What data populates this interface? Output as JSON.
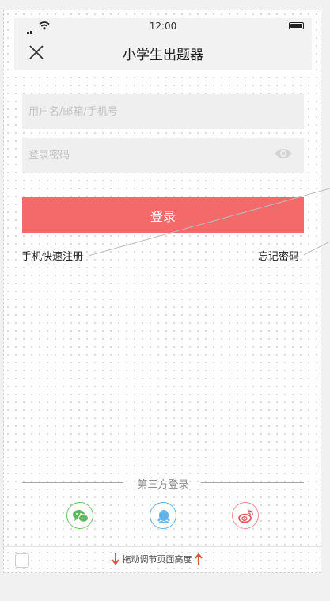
{
  "statusbar": {
    "time": "12:00"
  },
  "navbar": {
    "title": "小学生出题器"
  },
  "form": {
    "username_placeholder": "用户名/邮箱/手机号",
    "password_placeholder": "登录密码",
    "login_label": "登录",
    "register_link": "手机快速注册",
    "forgot_link": "忘记密码"
  },
  "third_party": {
    "label": "第三方登录",
    "providers": [
      "wechat-icon",
      "qq-icon",
      "weibo-icon"
    ]
  },
  "footer": {
    "drag_label": "拖动调节页面高度"
  },
  "colors": {
    "primary": "#f46a6a",
    "wechat": "#5cb85c",
    "qq": "#5fb3e8",
    "weibo": "#e05555",
    "arrow": "#e0533a"
  }
}
